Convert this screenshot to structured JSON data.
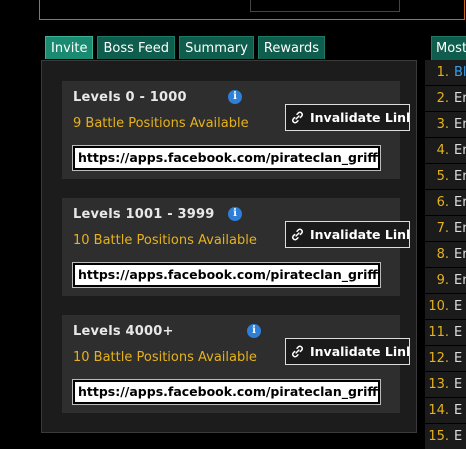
{
  "tabs": [
    {
      "label": "Invite",
      "active": true
    },
    {
      "label": "Boss Feed",
      "active": false
    },
    {
      "label": "Summary",
      "active": false
    },
    {
      "label": "Rewards",
      "active": false
    }
  ],
  "cards": [
    {
      "title": "Levels 0 - 1000",
      "available": "9 Battle Positions Available",
      "button_label": "Invalidate Link",
      "url": "https://apps.facebook.com/pirateclan_griffin/t"
    },
    {
      "title": "Levels 1001 - 3999",
      "available": "10 Battle Positions Available",
      "button_label": "Invalidate Link",
      "url": "https://apps.facebook.com/pirateclan_griffin/t"
    },
    {
      "title": "Levels 4000+",
      "available": "10 Battle Positions Available",
      "button_label": "Invalidate Link",
      "url": "https://apps.facebook.com/pirateclan_griffin/t"
    }
  ],
  "info_icon": "i",
  "right_panel": {
    "tab_label": "Most",
    "rows": [
      {
        "num": "1.",
        "name": "Bl"
      },
      {
        "num": "2.",
        "name": "Er"
      },
      {
        "num": "3.",
        "name": "Er"
      },
      {
        "num": "4.",
        "name": "Er"
      },
      {
        "num": "5.",
        "name": "Er"
      },
      {
        "num": "6.",
        "name": "Er"
      },
      {
        "num": "7.",
        "name": "Er"
      },
      {
        "num": "8.",
        "name": "Er"
      },
      {
        "num": "9.",
        "name": "Er"
      },
      {
        "num": "10.",
        "name": "E"
      },
      {
        "num": "11.",
        "name": "E"
      },
      {
        "num": "12.",
        "name": "E"
      },
      {
        "num": "13.",
        "name": "E"
      },
      {
        "num": "14.",
        "name": "E"
      },
      {
        "num": "15.",
        "name": "E"
      }
    ]
  },
  "colors": {
    "accent_orange": "#c8651b",
    "tab_green": "#0f5d4c",
    "gold_text": "#e6b21c",
    "info_blue": "#2f7fd6",
    "link_blue": "#3a9fe8"
  }
}
